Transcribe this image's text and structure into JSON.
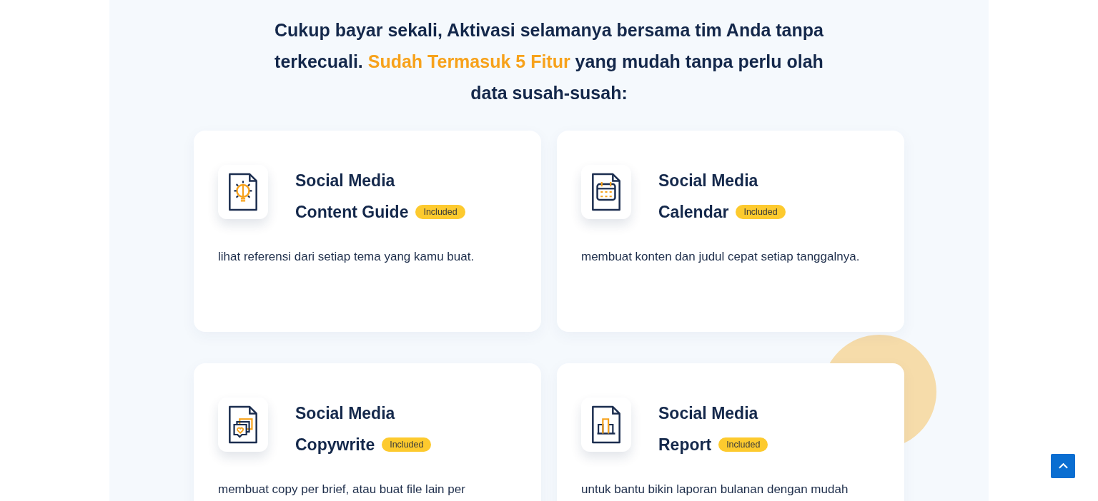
{
  "heading": "Cukup bayar sekali, Aktivasi selamanya bersama tim Anda tanpa terkecuali. **Sudah Termasuk 5 Fitur** yang mudah tanpa perlu olah data susah-susah:",
  "features": [
    {
      "kind": "guide",
      "title_lines": [
        "Social Media",
        "Content Guide"
      ],
      "badge": "Included",
      "description": "lihat referensi dari setiap tema yang kamu buat."
    },
    {
      "kind": "calendar",
      "title_lines": [
        "Social Media",
        "Calendar"
      ],
      "badge": "Included",
      "description": "membuat konten dan judul cepat setiap tanggalnya."
    },
    {
      "kind": "copywrite",
      "title_lines": [
        "Social Media",
        "Copywrite"
      ],
      "badge": "Included",
      "description": "membuat copy per brief, atau buat file lain per"
    },
    {
      "kind": "report",
      "title_lines": [
        "Social Media",
        "Report"
      ],
      "badge": "Included",
      "description": "untuk bantu bikin laporan bulanan dengan mudah"
    }
  ],
  "scroll_top": {
    "kind": "up"
  }
}
